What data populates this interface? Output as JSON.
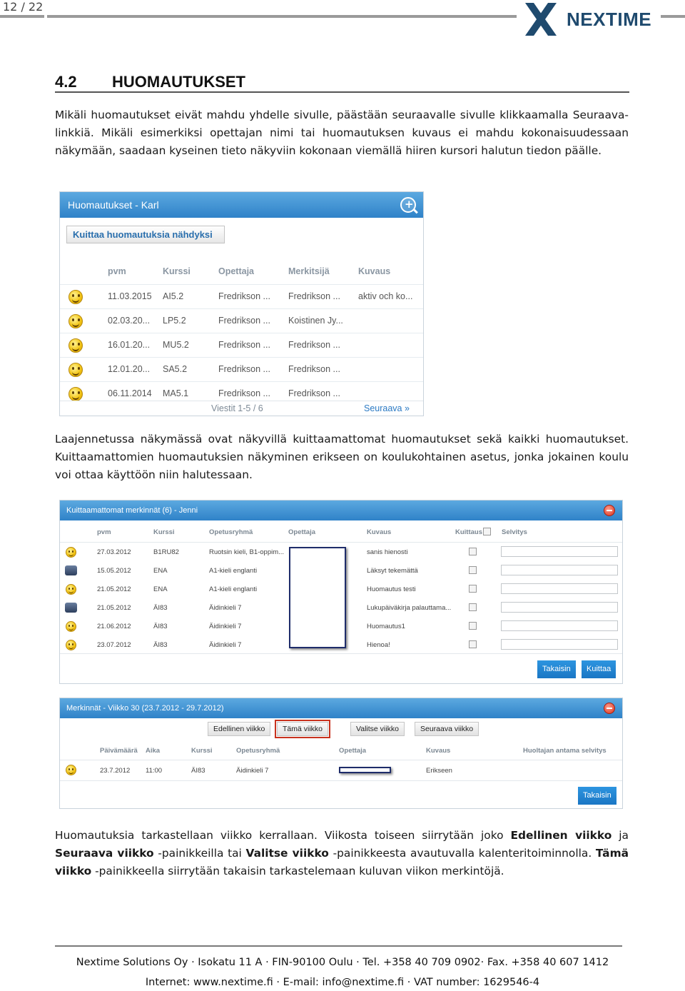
{
  "page_number": "12 / 22",
  "logo_text": "NEXTIME",
  "section": {
    "number": "4.2",
    "title": "HUOMAUTUKSET"
  },
  "para1": "Mikäli huomautukset eivät mahdu yhdelle sivulle, päästään seuraavalle sivulle klikkaamalla Seuraava-linkkiä. Mikäli esimerkiksi opettajan nimi tai huomautuksen kuvaus ei mahdu kokonaisuudessaan näkymään, saadaan kyseinen tieto näkyviin kokonaan viemällä hiiren kursori halutun tiedon päälle.",
  "shot1": {
    "title": "Huomautukset - Karl",
    "ack_button": "Kuittaa huomautuksia nähdyksi",
    "headers": [
      "pvm",
      "Kurssi",
      "Opettaja",
      "Merkitsijä",
      "Kuvaus"
    ],
    "rows": [
      [
        "11.03.2015",
        "AI5.2",
        "Fredrikson ...",
        "Fredrikson ...",
        "aktiv och ko..."
      ],
      [
        "02.03.20...",
        "LP5.2",
        "Fredrikson ...",
        "Koistinen Jy...",
        ""
      ],
      [
        "16.01.20...",
        "MU5.2",
        "Fredrikson ...",
        "Fredrikson ...",
        ""
      ],
      [
        "12.01.20...",
        "SA5.2",
        "Fredrikson ...",
        "Fredrikson ...",
        ""
      ],
      [
        "06.11.2014",
        "MA5.1",
        "Fredrikson ...",
        "Fredrikson ...",
        ""
      ]
    ],
    "pager": "Viestit 1-5 / 6",
    "next": "Seuraava »"
  },
  "para2": "Laajennetussa näkymässä ovat näkyvillä kuittaamattomat huomautukset sekä kaikki huomautukset. Kuittaamattomien huomautuksien näkyminen erikseen on koulukohtainen asetus, jonka jokainen koulu voi ottaa käyttöön niin halutessaan.",
  "shot2": {
    "title": "Kuittaamattomat merkinnät (6) - Jenni",
    "headers": [
      "pvm",
      "Kurssi",
      "Opetusryhmä",
      "Opettaja",
      "Kuvaus",
      "Kuittaus",
      "Selvitys"
    ],
    "rows": [
      [
        "27.03.2012",
        "B1RU82",
        "Ruotsin kieli, B1-oppim...",
        "sanis hienosti"
      ],
      [
        "15.05.2012",
        "ENA",
        "A1-kieli englanti",
        "Läksyt tekemättä"
      ],
      [
        "21.05.2012",
        "ENA",
        "A1-kieli englanti",
        "Huomautus testi"
      ],
      [
        "21.05.2012",
        "ÄI83",
        "Äidinkieli 7",
        "Lukupäiväkirja palauttama..."
      ],
      [
        "21.06.2012",
        "ÄI83",
        "Äidinkieli 7",
        "Huomautus1"
      ],
      [
        "23.07.2012",
        "ÄI83",
        "Äidinkieli 7",
        "Hienoa!"
      ]
    ],
    "back": "Takaisin",
    "ack": "Kuittaa"
  },
  "shot3": {
    "title": "Merkinnät - Viikko 30 (23.7.2012 - 29.7.2012)",
    "nav": [
      "Edellinen viikko",
      "Tämä viikko",
      "Valitse viikko",
      "Seuraava viikko"
    ],
    "headers": [
      "Päivämäärä",
      "Aika",
      "Kurssi",
      "Opetusryhmä",
      "Opettaja",
      "Kuvaus",
      "Huoltajan antama selvitys"
    ],
    "row": [
      "23.7.2012",
      "11:00",
      "ÄI83",
      "Äidinkieli 7",
      "Erikseen"
    ],
    "back": "Takaisin"
  },
  "para3": {
    "t1": "Huomautuksia tarkastellaan viikko kerrallaan. Viikosta toiseen siirrytään joko ",
    "b1": "Edellinen viikko",
    "t2": " ja ",
    "b2": "Seuraava viikko",
    "t3": " -painikkeilla tai ",
    "b3": "Valitse viikko",
    "t4": " -painikkeesta avautuvalla kalenteritoiminnolla. ",
    "b4": "Tämä viikko",
    "t5": " -painikkeella siirrytään takaisin tarkastelemaan kuluvan viikon merkintöjä."
  },
  "footer": {
    "line1": "Nextime Solutions Oy · Isokatu 11 A · FIN-90100 Oulu · Tel. +358 40 709 0902· Fax. +358 40 607 1412",
    "line2": "Internet: www.nextime.fi · E-mail: info@nextime.fi · VAT number: 1629546-4"
  }
}
